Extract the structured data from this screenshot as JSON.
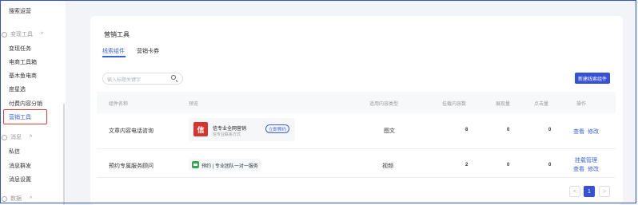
{
  "sidebar": {
    "items": [
      {
        "label": "搜索运营"
      },
      {
        "label": "变现工具"
      },
      {
        "label": "变现任务"
      },
      {
        "label": "电商工具箱"
      },
      {
        "label": "基木鱼电商"
      },
      {
        "label": "度星选"
      },
      {
        "label": "付费内容分销"
      },
      {
        "label": "营销工具"
      },
      {
        "label": "消息"
      },
      {
        "label": "私信"
      },
      {
        "label": "消息群发"
      },
      {
        "label": "消息设置"
      },
      {
        "label": "数据"
      }
    ],
    "collapse_glyph": "^"
  },
  "page": {
    "title": "营销工具",
    "tabs": [
      {
        "label": "线索组件"
      },
      {
        "label": "营销卡券"
      }
    ],
    "search_placeholder": "输入标题关键字",
    "create_button": "新建线索组件"
  },
  "table": {
    "columns": [
      "组件名称",
      "预览",
      "适用内容类型",
      "挂载内容数",
      "展现量",
      "点击量",
      "操作"
    ],
    "rows": [
      {
        "name": "文章内容电话咨询",
        "preview": {
          "logo_text": "信",
          "title": "信专业全网营销",
          "subtitle": "信专业联系方式",
          "button": "立即预约"
        },
        "type": "图文",
        "mounted": "8",
        "views": "0",
        "clicks": "0",
        "actions": [
          "查看",
          "修改"
        ]
      },
      {
        "name": "预约专属服务顾问",
        "preview": {
          "text": "预约 | 专业团队一对一服务"
        },
        "type": "视频",
        "mounted": "2",
        "views": "0",
        "clicks": "0",
        "actions": [
          "挂载管理",
          "查看",
          "修改"
        ]
      }
    ]
  },
  "pagination": {
    "prev": "<",
    "current": "1",
    "next": ">"
  },
  "colors": {
    "accent": "#3650d6",
    "active_border": "#e23b3b",
    "link": "#3a5fe0"
  }
}
